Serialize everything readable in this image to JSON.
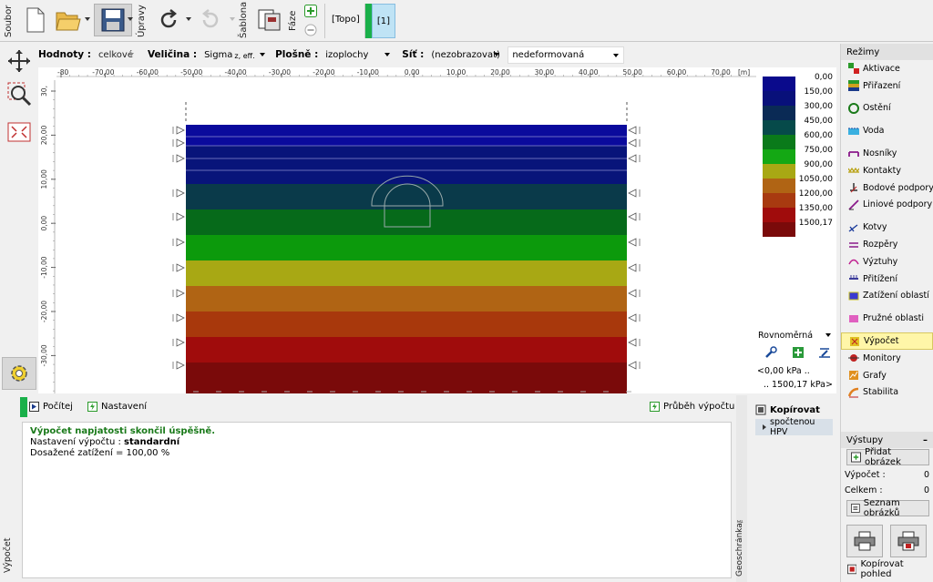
{
  "toolbar": {
    "soubor_label": "Soubor",
    "upravy_label": "Úpravy",
    "sablona_label": "Šablona",
    "faze_label": "Fáze",
    "topo_label": "[Topo]",
    "stage_label": "[1]"
  },
  "options": {
    "hodnoty_label": "Hodnoty :",
    "hodnoty_value": "celkové",
    "velicina_label": "Veličina :",
    "velicina_value": "Sigma",
    "velicina_sub": "z, eff.",
    "plosne_label": "Plošně :",
    "plosne_value": "izoplochy",
    "sit_label": "Síť :",
    "sit_value": "(nezobrazovat)",
    "deform_value": "nedeformovaná"
  },
  "ruler": {
    "x_ticks": [
      "-80",
      "-70,00",
      "-60,00",
      "-50,00",
      "-40,00",
      "-30,00",
      "-20,00",
      "-10,00",
      "0,00",
      "10,00",
      "20,00",
      "30,00",
      "40,00",
      "50,00",
      "60,00",
      "70,00"
    ],
    "unit": "[m]",
    "y_ticks": [
      "30,",
      "20,00",
      "10,00",
      "0,00",
      "-10,00",
      "-20,00",
      "-30,00"
    ]
  },
  "legend": {
    "values": [
      "0,00",
      "150,00",
      "300,00",
      "450,00",
      "600,00",
      "750,00",
      "900,00",
      "1050,00",
      "1200,00",
      "1350,00",
      "1500,17"
    ],
    "colors": [
      "#0a0a8c",
      "#08107a",
      "#0a2a55",
      "#064a4a",
      "#0a7a1a",
      "#14a814",
      "#a8a814",
      "#b06414",
      "#a83a10",
      "#a00c0c",
      "#7a0a0a"
    ],
    "mode": "Rovnoměrná",
    "min_text": "<0,00 kPa ..",
    "max_text": ".. 1500,17 kPa>"
  },
  "rezimy": {
    "title": "Režimy",
    "items": [
      {
        "label": "Aktivace",
        "icon": "activation-icon"
      },
      {
        "label": "Přiřazení",
        "icon": "assign-icon"
      },
      {
        "label": "Ostění",
        "icon": "lining-icon"
      },
      {
        "label": "Voda",
        "icon": "water-icon"
      },
      {
        "label": "Nosníky",
        "icon": "beam-icon"
      },
      {
        "label": "Kontakty",
        "icon": "contact-icon"
      },
      {
        "label": "Bodové podpory",
        "icon": "point-support-icon"
      },
      {
        "label": "Liniové podpory",
        "icon": "line-support-icon"
      },
      {
        "label": "Kotvy",
        "icon": "anchor-icon"
      },
      {
        "label": "Rozpěry",
        "icon": "strut-icon"
      },
      {
        "label": "Výztuhy",
        "icon": "reinforcement-icon"
      },
      {
        "label": "Přitížení",
        "icon": "surcharge-icon"
      },
      {
        "label": "Zatížení oblastí",
        "icon": "region-load-icon"
      },
      {
        "label": "Pružné oblasti",
        "icon": "elastic-region-icon"
      },
      {
        "label": "Výpočet",
        "icon": "calculation-icon"
      },
      {
        "label": "Monitory",
        "icon": "monitor-icon"
      },
      {
        "label": "Grafy",
        "icon": "graph-icon"
      },
      {
        "label": "Stabilita",
        "icon": "stability-icon"
      }
    ]
  },
  "vystupy": {
    "title": "Výstupy",
    "add_image": "Přidat obrázek",
    "vypocet_label": "Výpočet :",
    "vypocet_count": "0",
    "celkem_label": "Celkem :",
    "celkem_count": "0",
    "list_images": "Seznam obrázků",
    "copy_view": "Kopírovat pohled"
  },
  "bottom": {
    "pocitej": "Počítej",
    "nastaveni": "Nastavení",
    "prubeh": "Průběh výpočtu",
    "vypocet_side": "Výpočet",
    "result_title": "Výpočet napjatosti skončil úspěšně.",
    "result_line1_label": "Nastavení výpočtu :",
    "result_line1_value": "standardní",
    "result_line2": "Dosažené zatížení = 100,00 %",
    "geoschranka": "Geoschránka™",
    "kopirovat": "Kopírovat",
    "spoctenou": "spočtenou HPV"
  }
}
